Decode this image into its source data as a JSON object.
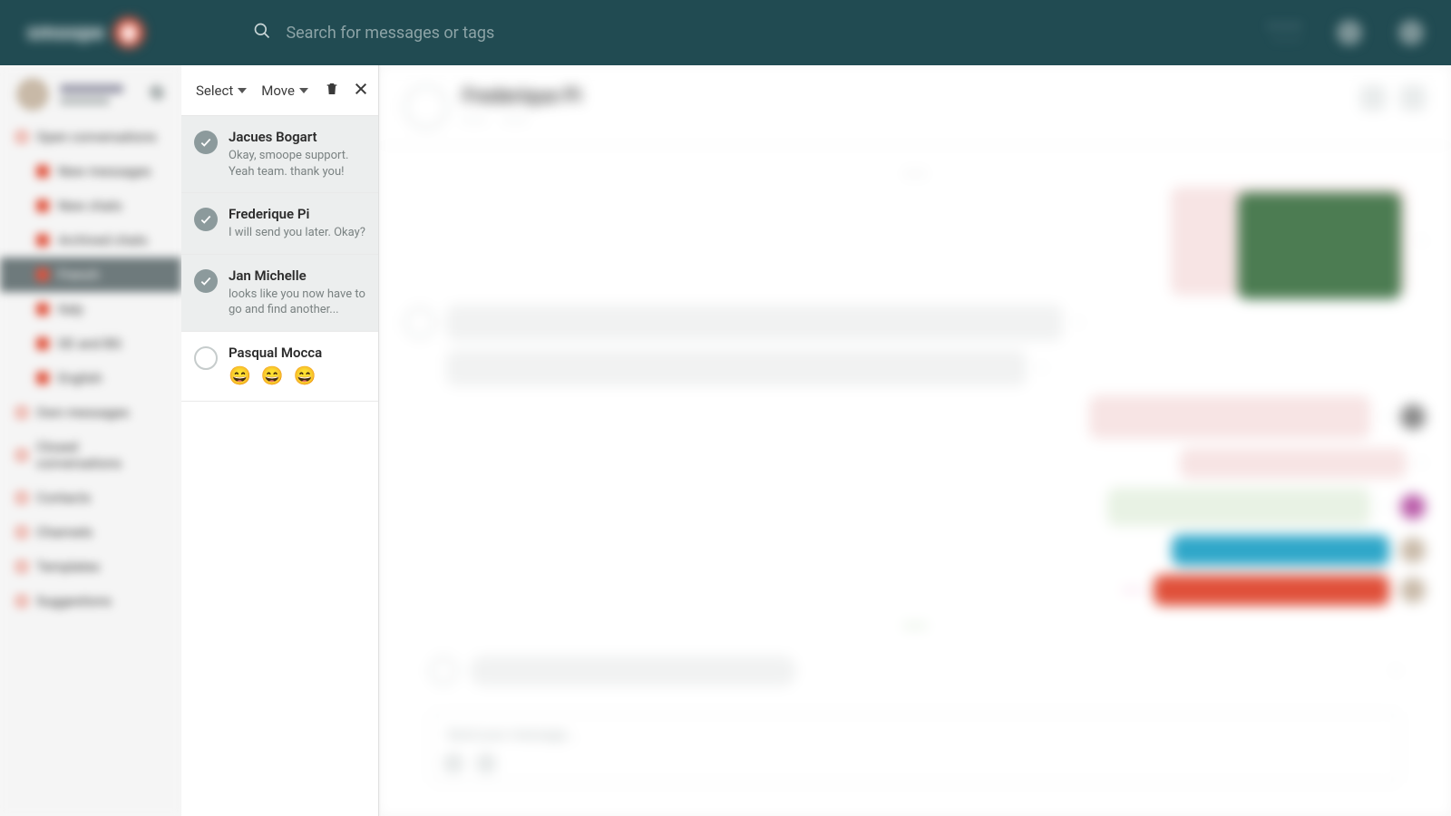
{
  "header": {
    "brand": "smoope",
    "search_placeholder": "Search for messages or tags"
  },
  "nav": {
    "items": [
      {
        "label": "Open conversations",
        "icon": "outline"
      },
      {
        "label": "New messages",
        "icon": "solid",
        "sub": true
      },
      {
        "label": "New chats",
        "icon": "solid",
        "sub": true
      },
      {
        "label": "Archived chats",
        "icon": "solid",
        "sub": true
      },
      {
        "label": "French",
        "icon": "solid",
        "sub": true,
        "selected": true
      },
      {
        "label": "Italy",
        "icon": "solid",
        "sub": true
      },
      {
        "label": "DE and BG",
        "icon": "solid",
        "sub": true
      },
      {
        "label": "English",
        "icon": "solid",
        "sub": true
      },
      {
        "label": "Own messages",
        "icon": "outline"
      },
      {
        "label": "Closed conversations",
        "icon": "outline"
      },
      {
        "label": "Contacts",
        "icon": "outline"
      },
      {
        "label": "Channels",
        "icon": "outline"
      },
      {
        "label": "Templates",
        "icon": "outline"
      },
      {
        "label": "Suggestions",
        "icon": "outline"
      }
    ]
  },
  "toolbar": {
    "select_label": "Select",
    "move_label": "Move"
  },
  "conversations": [
    {
      "name": "Jacues Bogart",
      "preview": "Okay, smoope support. Yeah team. thank you!",
      "checked": true,
      "selected": true
    },
    {
      "name": "Frederique Pi",
      "preview": "I will send you later. Okay?",
      "checked": true,
      "selected": true
    },
    {
      "name": "Jan Michelle",
      "preview": "looks like you now have to go and find another...",
      "checked": true,
      "selected": true
    },
    {
      "name": "Pasqual Mocca",
      "preview": "😄 😄 😄",
      "emoji": true,
      "checked": false,
      "selected": false
    }
  ],
  "chat": {
    "title": "Frederique Pi",
    "compose_placeholder": "Send your message..."
  }
}
